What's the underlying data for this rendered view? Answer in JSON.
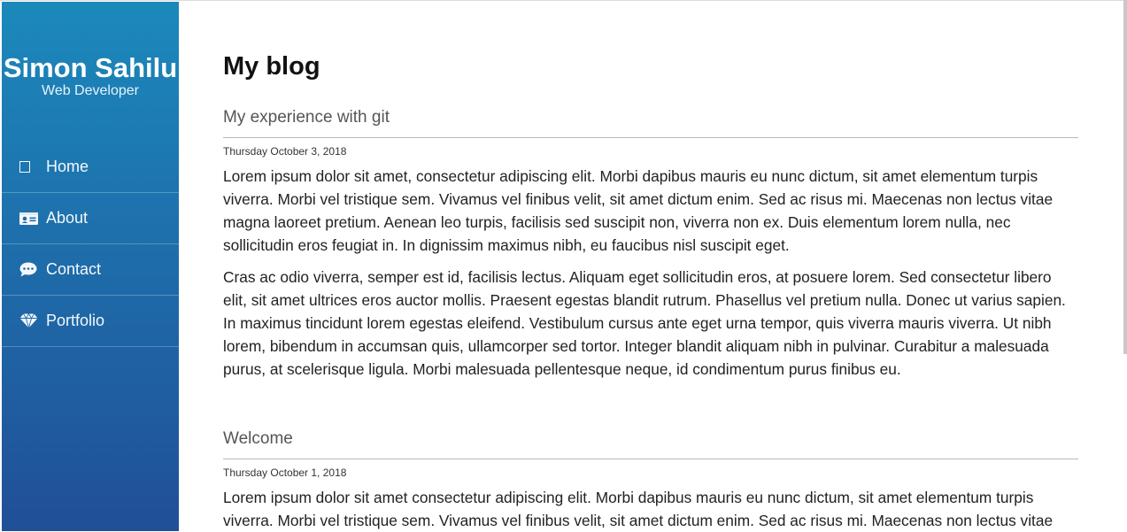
{
  "sidebar": {
    "name": "Simon Sahilu",
    "role": "Web Developer",
    "items": [
      {
        "label": "Home",
        "icon": "home-icon"
      },
      {
        "label": "About",
        "icon": "id-card-icon"
      },
      {
        "label": "Contact",
        "icon": "comment-icon"
      },
      {
        "label": "Portfolio",
        "icon": "diamond-icon"
      }
    ]
  },
  "main": {
    "title": "My blog",
    "posts": [
      {
        "title": "My experience with git",
        "date": "Thursday October 3, 2018",
        "paragraphs": [
          "Lorem ipsum dolor sit amet, consectetur adipiscing elit. Morbi dapibus mauris eu nunc dictum, sit amet elementum turpis viverra. Morbi vel tristique sem. Vivamus vel finibus velit, sit amet dictum enim. Sed ac risus mi. Maecenas non lectus vitae magna laoreet pretium. Aenean leo turpis, facilisis sed suscipit non, viverra non ex. Duis elementum lorem nulla, nec sollicitudin eros feugiat in. In dignissim maximus nibh, eu faucibus nisl suscipit eget.",
          "Cras ac odio viverra, semper est id, facilisis lectus. Aliquam eget sollicitudin eros, at posuere lorem. Sed consectetur libero elit, sit amet ultrices eros auctor mollis. Praesent egestas blandit rutrum. Phasellus vel pretium nulla. Donec ut varius sapien. In maximus tincidunt lorem egestas eleifend. Vestibulum cursus ante eget urna tempor, quis viverra mauris viverra. Ut nibh lorem, bibendum in accumsan quis, ullamcorper sed tortor. Integer blandit aliquam nibh in pulvinar. Curabitur a malesuada purus, at scelerisque ligula. Morbi malesuada pellentesque neque, id condimentum purus finibus eu."
        ]
      },
      {
        "title": "Welcome",
        "date": "Thursday October 1, 2018",
        "paragraphs": [
          "Lorem ipsum dolor sit amet consectetur adipiscing elit. Morbi dapibus mauris eu nunc dictum, sit amet elementum turpis viverra. Morbi vel tristique sem. Vivamus vel finibus velit, sit amet dictum enim. Sed ac risus mi. Maecenas non lectus vitae"
        ]
      }
    ]
  },
  "colors": {
    "sidebar_top": "#1b89bb",
    "sidebar_bottom": "#204f97"
  }
}
